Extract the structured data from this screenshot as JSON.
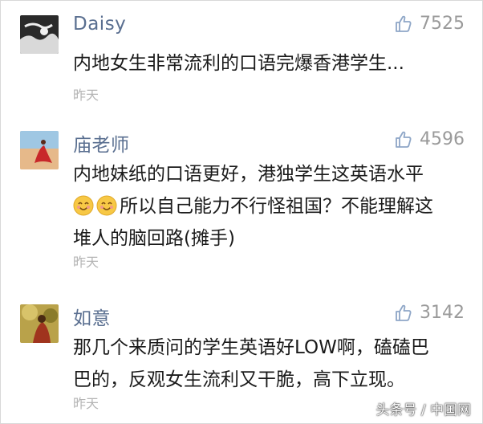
{
  "comments": [
    {
      "username": "Daisy",
      "likes": "7525",
      "text_lines": [
        "内地女生非常流利的口语完爆香港学生..."
      ],
      "time": "昨天"
    },
    {
      "username": "庙老师",
      "likes": "4596",
      "text_lines": [
        "内地妹纸的口语更好，港独学生这英语水平",
        "所以自己能力不行怪祖国？不能理解这",
        "堆人的脑回路(摊手)"
      ],
      "time": "昨天"
    },
    {
      "username": "如意",
      "likes": "3142",
      "text_lines": [
        "那几个来质问的学生英语好LOW啊，磕磕巴",
        "巴的，反观女生流利又干脆，高下立现。"
      ],
      "time": "昨天"
    }
  ],
  "watermark": {
    "text": "头条号 / 中国网"
  },
  "icons": {
    "like": "thumbs-up-icon",
    "emoji": "smile-emoji-icon"
  },
  "colors": {
    "username": "#5a6f90",
    "like": "#9a9a9a",
    "time": "#b4b4b4"
  }
}
